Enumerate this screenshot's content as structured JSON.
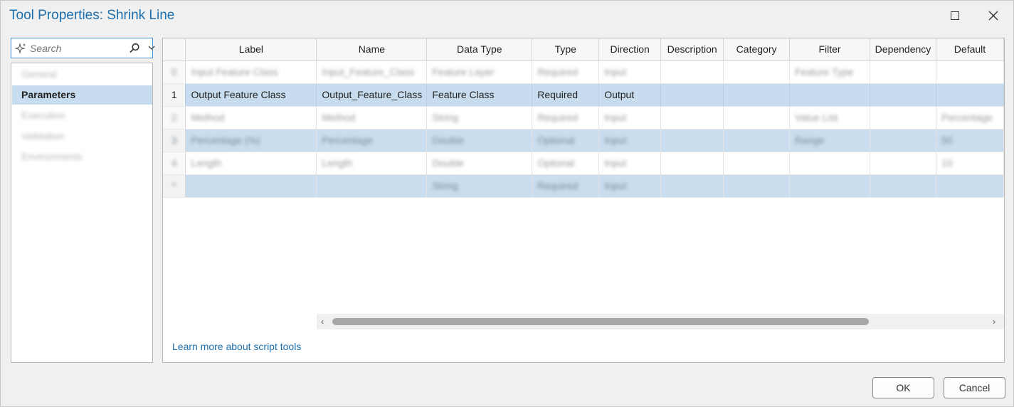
{
  "window": {
    "title": "Tool Properties: Shrink Line",
    "maximize_icon": "maximize-icon",
    "close_icon": "close-icon"
  },
  "search": {
    "placeholder": "Search",
    "icons": [
      "sparkle-icon",
      "search-icon",
      "chevron-down-icon"
    ]
  },
  "nav": {
    "items": [
      {
        "label": "General",
        "state": "blurred"
      },
      {
        "label": "Parameters",
        "state": "selected"
      },
      {
        "label": "Execution",
        "state": "blurred"
      },
      {
        "label": "Validation",
        "state": "blurred"
      },
      {
        "label": "Environments",
        "state": "blurred"
      }
    ]
  },
  "grid": {
    "columns": [
      "",
      "Label",
      "Name",
      "Data Type",
      "Type",
      "Direction",
      "Description",
      "Category",
      "Filter",
      "Dependency",
      "Default"
    ],
    "rows": [
      {
        "cells": [
          "0",
          "Input Feature Class",
          "Input_Feature_Class",
          "Feature Layer",
          "Required",
          "Input",
          "",
          "",
          "Feature Type",
          "",
          ""
        ],
        "blurred": true,
        "highlight": false
      },
      {
        "cells": [
          "1",
          "Output Feature Class",
          "Output_Feature_Class",
          "Feature Class",
          "Required",
          "Output",
          "",
          "",
          "",
          "",
          ""
        ],
        "blurred": false,
        "highlight": true,
        "selected": true
      },
      {
        "cells": [
          "2",
          "Method",
          "Method",
          "String",
          "Required",
          "Input",
          "",
          "",
          "Value List",
          "",
          "Percentage"
        ],
        "blurred": true,
        "highlight": false
      },
      {
        "cells": [
          "3",
          "Percentage (%)",
          "Percentage",
          "Double",
          "Optional",
          "Input",
          "",
          "",
          "Range",
          "",
          "50"
        ],
        "blurred": true,
        "highlight": true
      },
      {
        "cells": [
          "4",
          "Length",
          "Length",
          "Double",
          "Optional",
          "Input",
          "",
          "",
          "",
          "",
          "10"
        ],
        "blurred": true,
        "highlight": false
      },
      {
        "cells": [
          "*",
          "",
          "",
          "String",
          "Required",
          "Input",
          "",
          "",
          "",
          "",
          ""
        ],
        "blurred": true,
        "highlight": true
      }
    ]
  },
  "scrollbar": {
    "left_arrow": "‹",
    "right_arrow": "›"
  },
  "footer": {
    "learn_more": "Learn more about script tools",
    "ok_label": "OK",
    "cancel_label": "Cancel"
  }
}
